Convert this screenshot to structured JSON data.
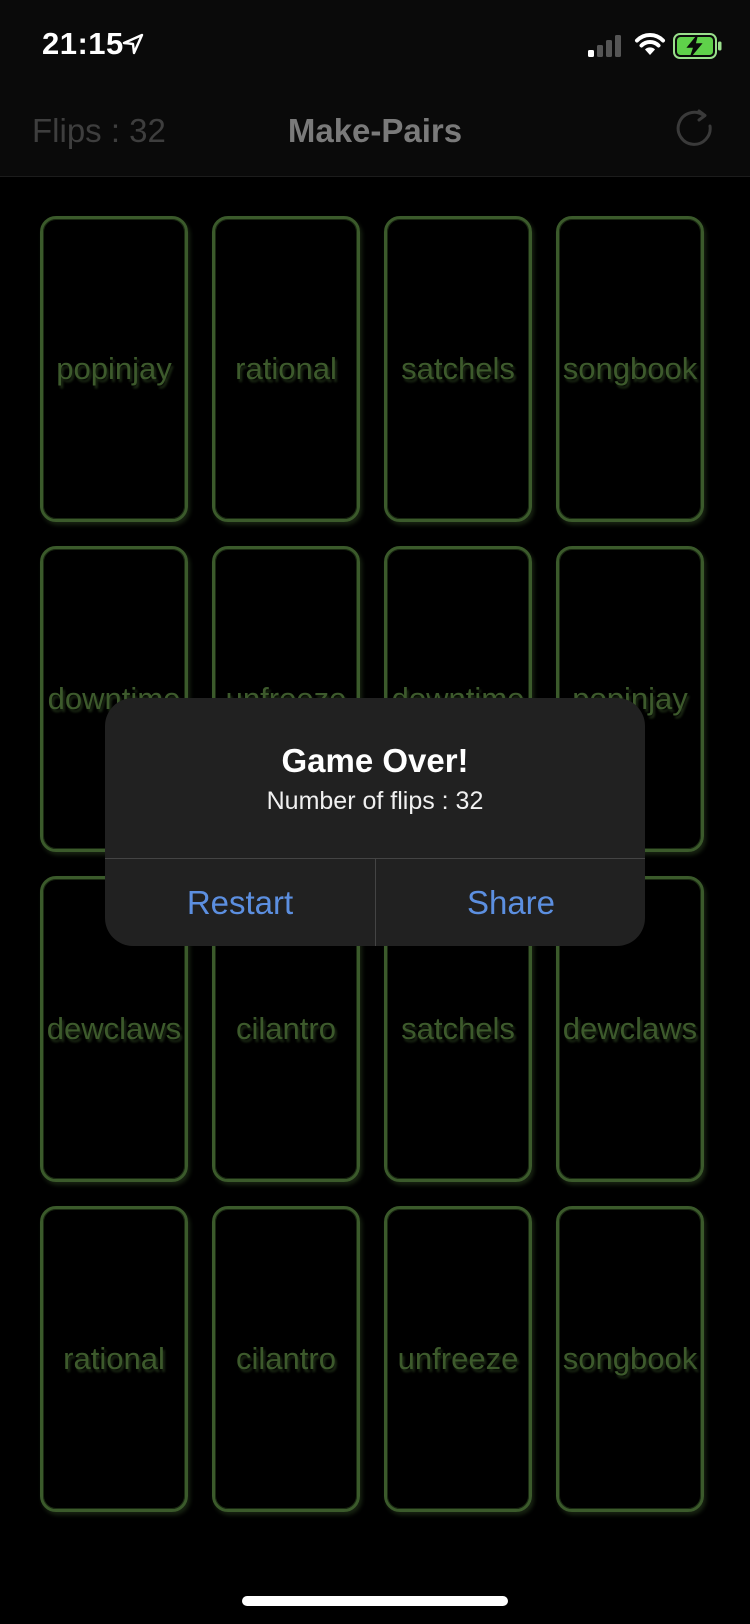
{
  "status": {
    "time": "21:15"
  },
  "nav": {
    "flips": "Flips : 32",
    "title": "Make-Pairs"
  },
  "cards": [
    "popinjay",
    "rational",
    "satchels",
    "songbook",
    "downtime",
    "unfreeze",
    "downtime",
    "popinjay",
    "dewclaws",
    "cilantro",
    "satchels",
    "dewclaws",
    "rational",
    "cilantro",
    "unfreeze",
    "songbook"
  ],
  "alert": {
    "title": "Game Over!",
    "message": "Number of flips : 32",
    "restart_label": "Restart",
    "share_label": "Share"
  },
  "colors": {
    "card_border": "#3b5a2b",
    "card_text": "#3d5a2c",
    "action_blue": "#5c8fe0"
  }
}
